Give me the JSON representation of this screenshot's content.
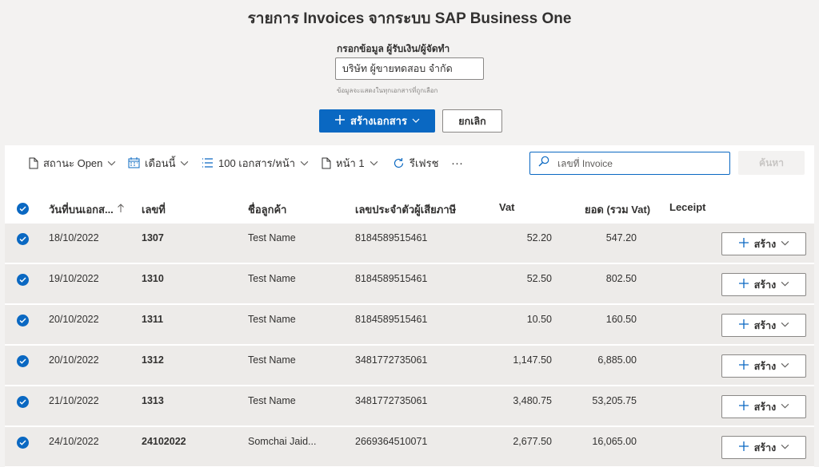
{
  "title": "รายการ Invoices จากระบบ SAP Business One",
  "payer_form": {
    "label": "กรอกข้อมูล ผู้รับเงิน/ผู้จัดทำ",
    "value": "บริษัท ผู้ขายทดสอบ จำกัด",
    "hint": "ข้อมูลจะแสดงในทุกเอกสารที่ถูกเลือก"
  },
  "actions": {
    "create_label": "สร้างเอกสาร",
    "cancel_label": "ยกเลิก"
  },
  "toolbar": {
    "status_label": "สถานะ Open",
    "period_label": "เดือนนี้",
    "page_size_label": "100 เอกสาร/หน้า",
    "page_label": "หน้า 1",
    "refresh_label": "รีเฟรช",
    "more_label": "···",
    "search_placeholder": "เลขที่ Invoice",
    "search_button_label": "ค้นหา"
  },
  "columns": {
    "doc_date": "วันที่บนเอกส...",
    "doc_no": "เลขที่",
    "customer": "ชื่อลูกค้า",
    "tax_id": "เลขประจำตัวผู้เสียภาษี",
    "vat": "Vat",
    "total": "ยอด (รวม Vat)",
    "receipt": "Leceipt"
  },
  "row_button_label": "สร้าง",
  "rows": [
    {
      "date": "18/10/2022",
      "no": "1307",
      "customer": "Test Name",
      "tax_id": "8184589515461",
      "vat": "52.20",
      "total": "547.20"
    },
    {
      "date": "19/10/2022",
      "no": "1310",
      "customer": "Test Name",
      "tax_id": "8184589515461",
      "vat": "52.50",
      "total": "802.50"
    },
    {
      "date": "20/10/2022",
      "no": "1311",
      "customer": "Test Name",
      "tax_id": "8184589515461",
      "vat": "10.50",
      "total": "160.50"
    },
    {
      "date": "20/10/2022",
      "no": "1312",
      "customer": "Test Name",
      "tax_id": "3481772735061",
      "vat": "1,147.50",
      "total": "6,885.00"
    },
    {
      "date": "21/10/2022",
      "no": "1313",
      "customer": "Test Name",
      "tax_id": "3481772735061",
      "vat": "3,480.75",
      "total": "53,205.75"
    },
    {
      "date": "24/10/2022",
      "no": "24102022",
      "customer": "Somchai Jaid...",
      "tax_id": "2669364510071",
      "vat": "2,677.50",
      "total": "16,065.00"
    }
  ],
  "colors": {
    "accent": "#0a68c2",
    "row_selected": "#edebe9",
    "background": "#f3f2f1"
  }
}
